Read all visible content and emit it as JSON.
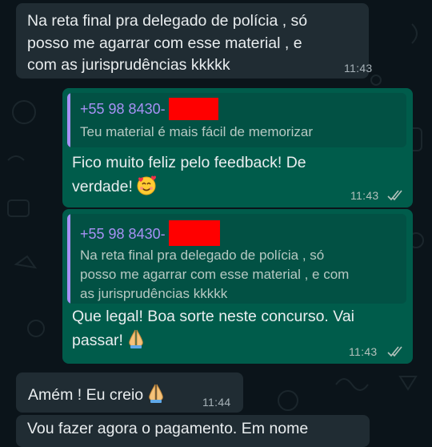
{
  "colors": {
    "background": "#0b141a",
    "incoming_bubble": "#202c33",
    "outgoing_bubble": "#005c4b",
    "quote_background": "#025144",
    "quote_author": "#a791f5",
    "read_ticks": "#b3c2bc",
    "redaction": "#ff0000"
  },
  "messages": [
    {
      "direction": "incoming",
      "text": "Na reta final pra delegado de polícia , só\nposso me agarrar com esse material , e\ncom as jurisprudências kkkkk",
      "time": "11:43"
    },
    {
      "direction": "outgoing",
      "quote": {
        "author": "+55 98 8430-",
        "text": "Teu material é mais fácil de memorizar"
      },
      "text": "Fico muito feliz pelo feedback! De\nverdade!",
      "emoji": "smiling-face-with-hearts",
      "time": "11:43",
      "status": "read"
    },
    {
      "direction": "outgoing",
      "quote": {
        "author": "+55 98 8430-",
        "text": "Na reta final pra delegado de polícia , só\nposso me agarrar com esse material , e com\nas jurisprudências kkkkk"
      },
      "text": "Que legal! Boa sorte neste concurso. Vai\npassar!",
      "emoji": "folded-hands",
      "time": "11:43",
      "status": "read"
    },
    {
      "direction": "incoming",
      "text": "Amém ! Eu creio",
      "emoji": "folded-hands",
      "time": "11:44"
    },
    {
      "direction": "incoming",
      "text": "Vou fazer agora o pagamento. Em nome"
    }
  ]
}
